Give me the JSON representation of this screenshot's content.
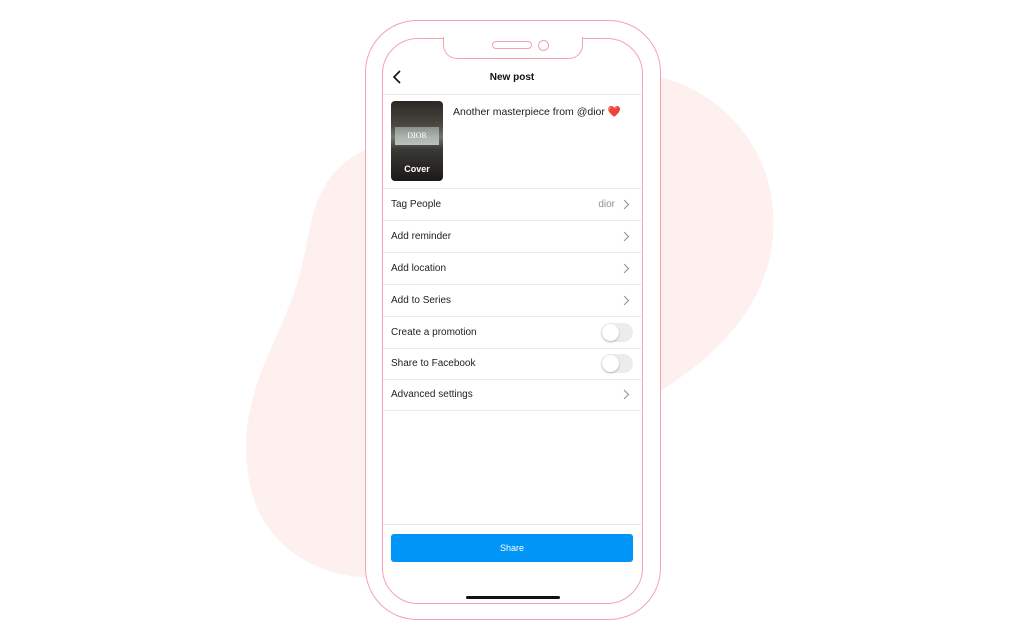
{
  "colors": {
    "accent": "#0095f6",
    "phone_outline": "#f4a3ad",
    "blob": "#fdf0ef"
  },
  "header": {
    "title": "New post",
    "back_icon": "chevron-left-icon"
  },
  "post": {
    "thumbnail_brand": "DIOR",
    "cover_label": "Cover",
    "caption": "Another masterpiece from @dior",
    "caption_emoji": "❤️"
  },
  "rows": [
    {
      "label": "Tag People",
      "value": "dior",
      "type": "chevron"
    },
    {
      "label": "Add reminder",
      "value": "",
      "type": "chevron"
    },
    {
      "label": "Add location",
      "value": "",
      "type": "chevron"
    },
    {
      "label": "Add to Series",
      "value": "",
      "type": "chevron"
    },
    {
      "label": "Create a promotion",
      "type": "toggle",
      "on": false
    },
    {
      "label": "Share to Facebook",
      "type": "toggle",
      "on": false
    },
    {
      "label": "Advanced settings",
      "value": "",
      "type": "chevron"
    }
  ],
  "footer": {
    "share_label": "Share"
  }
}
